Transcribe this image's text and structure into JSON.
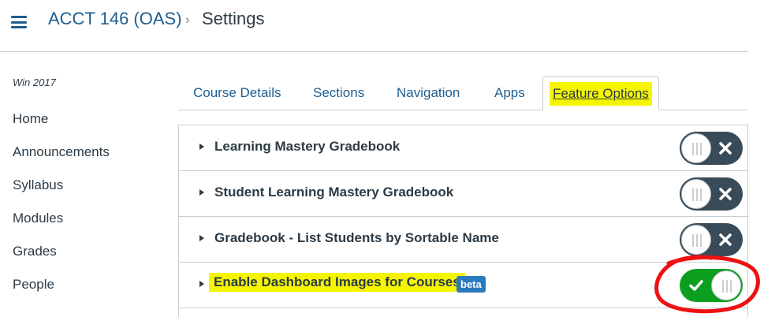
{
  "header": {
    "course": "ACCT 146 (OAS)",
    "separator": "›",
    "current": "Settings"
  },
  "sidebar": {
    "term": "Win 2017",
    "items": [
      {
        "label": "Home"
      },
      {
        "label": "Announcements"
      },
      {
        "label": "Syllabus"
      },
      {
        "label": "Modules"
      },
      {
        "label": "Grades"
      },
      {
        "label": "People"
      }
    ]
  },
  "tabs": [
    {
      "label": "Course Details"
    },
    {
      "label": "Sections"
    },
    {
      "label": "Navigation"
    },
    {
      "label": "Apps"
    },
    {
      "label": "Feature Options",
      "active": true
    }
  ],
  "features": [
    {
      "title": "Learning Mastery Gradebook",
      "enabled": false
    },
    {
      "title": "Student Learning Mastery Gradebook",
      "enabled": false
    },
    {
      "title": "Gradebook - List Students by Sortable Name",
      "enabled": false
    },
    {
      "title": "Enable Dashboard Images for Courses",
      "badge": "beta",
      "enabled": true
    }
  ],
  "colors": {
    "link": "#1e5e91",
    "highlight": "#f5f500",
    "toggle_off": "#394b58",
    "toggle_on": "#0c9f1f",
    "badge": "#2b7abc",
    "annotation": "#ee1111"
  },
  "icons": {
    "menu": "hamburger-icon",
    "collapse": "caret-right-icon",
    "off": "x-icon",
    "on": "check-icon"
  }
}
